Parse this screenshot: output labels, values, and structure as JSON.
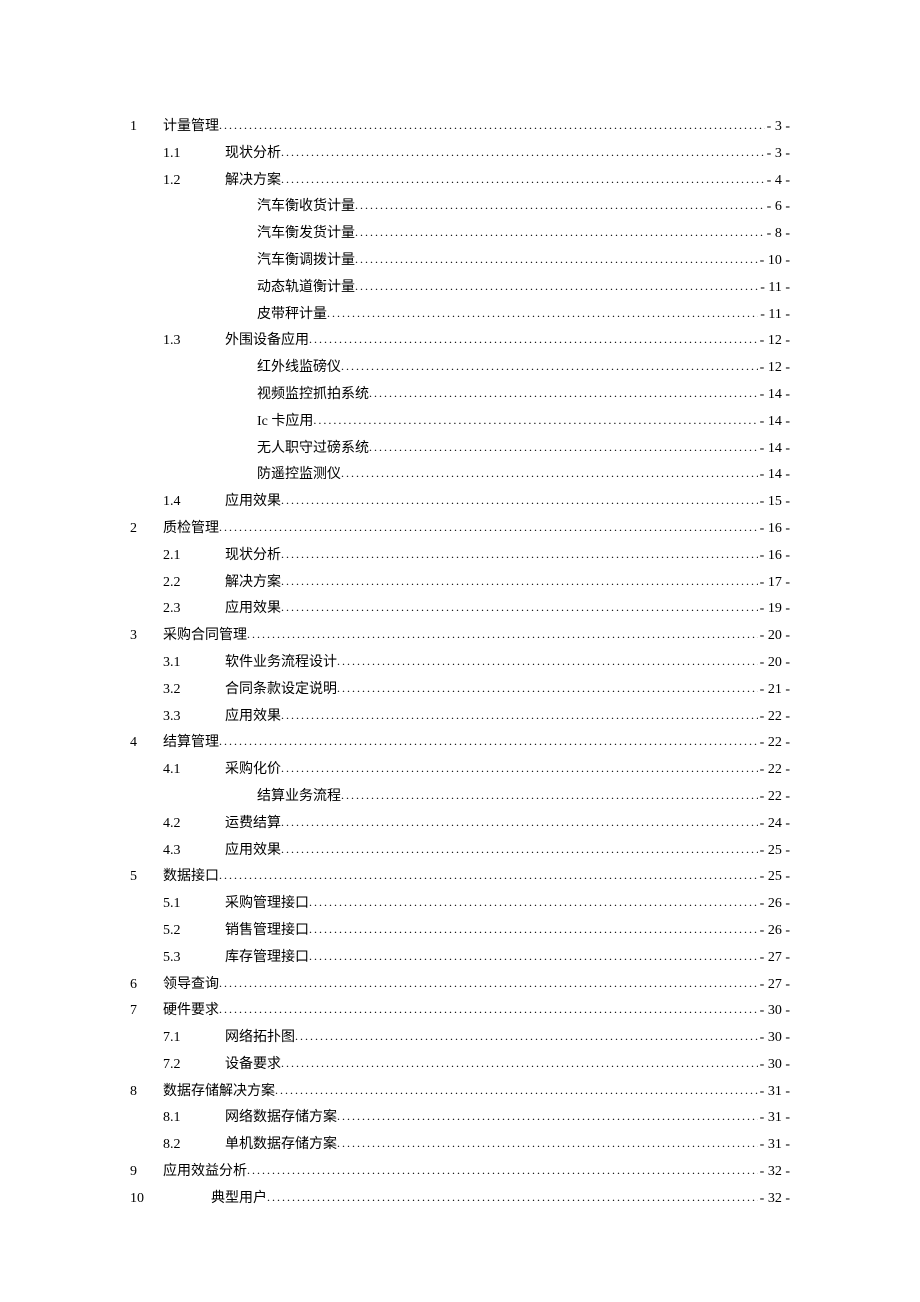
{
  "toc": [
    {
      "level": 1,
      "num": "1",
      "title": "计量管理",
      "page": "- 3 -"
    },
    {
      "level": 2,
      "num": "1.1",
      "title": "现状分析",
      "page": "- 3 -"
    },
    {
      "level": 2,
      "num": "1.2",
      "title": "解决方案",
      "page": "- 4 -"
    },
    {
      "level": 3,
      "num": "",
      "title": "汽车衡收货计量",
      "page": "- 6 -"
    },
    {
      "level": 3,
      "num": "",
      "title": "汽车衡发货计量",
      "page": "- 8 -"
    },
    {
      "level": 3,
      "num": "",
      "title": "汽车衡调拨计量",
      "page": "- 10 -"
    },
    {
      "level": 3,
      "num": "",
      "title": "动态轨道衡计量",
      "page": "- 11 -"
    },
    {
      "level": 3,
      "num": "",
      "title": "皮带秤计量",
      "page": "- 11 -"
    },
    {
      "level": 2,
      "num": "1.3",
      "title": "外围设备应用",
      "page": "- 12 -"
    },
    {
      "level": 3,
      "num": "",
      "title": "红外线监磅仪",
      "page": "- 12 -"
    },
    {
      "level": 3,
      "num": "",
      "title": "视频监控抓拍系统",
      "page": "- 14 -"
    },
    {
      "level": 3,
      "num": "",
      "title": "Ic 卡应用",
      "page": "- 14 -"
    },
    {
      "level": 3,
      "num": "",
      "title": "无人职守过磅系统",
      "page": "- 14 -"
    },
    {
      "level": 3,
      "num": "",
      "title": "防遥控监测仪",
      "page": "- 14 -"
    },
    {
      "level": 2,
      "num": "1.4",
      "title": "应用效果",
      "page": "- 15 -"
    },
    {
      "level": 1,
      "num": "2",
      "title": "质检管理",
      "page": "- 16 -"
    },
    {
      "level": 2,
      "num": "2.1",
      "title": "现状分析",
      "page": "- 16 -"
    },
    {
      "level": 2,
      "num": "2.2",
      "title": "解决方案",
      "page": "- 17 -"
    },
    {
      "level": 2,
      "num": "2.3",
      "title": "应用效果",
      "page": "- 19 -"
    },
    {
      "level": 1,
      "num": "3",
      "title": "采购合同管理",
      "page": "- 20 -"
    },
    {
      "level": 2,
      "num": "3.1",
      "title": "软件业务流程设计",
      "page": "- 20 -"
    },
    {
      "level": 2,
      "num": "3.2",
      "title": "合同条款设定说明",
      "page": "- 21 -"
    },
    {
      "level": 2,
      "num": "3.3",
      "title": "应用效果",
      "page": "- 22 -"
    },
    {
      "level": 1,
      "num": "4",
      "title": "结算管理",
      "page": "- 22 -"
    },
    {
      "level": 2,
      "num": "4.1",
      "title": "采购化价",
      "page": "- 22 -"
    },
    {
      "level": 3,
      "num": "",
      "title": "结算业务流程",
      "page": "- 22 -"
    },
    {
      "level": 2,
      "num": "4.2",
      "title": "运费结算",
      "page": "- 24 -"
    },
    {
      "level": 2,
      "num": "4.3",
      "title": "应用效果",
      "page": "- 25 -"
    },
    {
      "level": 1,
      "num": "5",
      "title": "数据接口",
      "page": "- 25 -"
    },
    {
      "level": 2,
      "num": "5.1",
      "title": "采购管理接口",
      "page": "- 26 -"
    },
    {
      "level": 2,
      "num": "5.2",
      "title": "销售管理接口",
      "page": "- 26 -"
    },
    {
      "level": 2,
      "num": "5.3",
      "title": "库存管理接口",
      "page": "- 27 -"
    },
    {
      "level": 1,
      "num": "6",
      "title": "领导查询",
      "page": "- 27 -"
    },
    {
      "level": 1,
      "num": "7",
      "title": "硬件要求",
      "page": "- 30 -"
    },
    {
      "level": 2,
      "num": "7.1",
      "title": "网络拓扑图",
      "page": "- 30 -"
    },
    {
      "level": 2,
      "num": "7.2",
      "title": "设备要求",
      "page": "- 30 -"
    },
    {
      "level": 1,
      "num": "8",
      "title": "数据存储解决方案",
      "page": "- 31 -"
    },
    {
      "level": 2,
      "num": "8.1",
      "title": "网络数据存储方案",
      "page": "- 31 -"
    },
    {
      "level": 2,
      "num": "8.2",
      "title": "单机数据存储方案",
      "page": "- 31 -"
    },
    {
      "level": 1,
      "num": "9",
      "title": "应用效益分析",
      "page": "- 32 -"
    },
    {
      "level": 1,
      "num": "10",
      "title": "典型用户",
      "page": "- 32 -",
      "shiftedTitle": true
    }
  ]
}
